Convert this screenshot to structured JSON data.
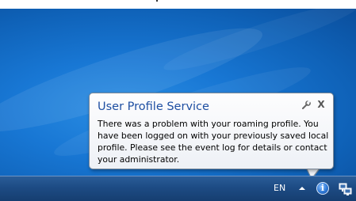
{
  "notification": {
    "title": "User Profile Service",
    "body": "There was a problem with your roaming profile. You have been logged on with your previously saved local profile. Please see the event log for details or contact your administrator.",
    "close_label": "X",
    "options_icon": "wrench-icon"
  },
  "taskbar": {
    "language": "EN",
    "tray_expand_icon": "chevron-up-icon",
    "info_icon": "info-icon",
    "info_glyph": "i",
    "network_icon": "network-icon"
  },
  "colors": {
    "desktop": "#1877d4",
    "title": "#1e4fa2",
    "taskbar": "#1d4b84"
  }
}
